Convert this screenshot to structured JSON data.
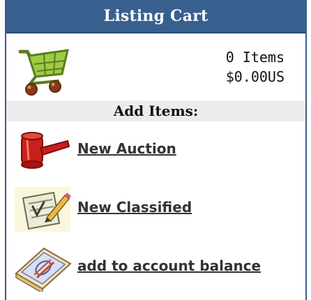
{
  "header": {
    "title": "Listing Cart"
  },
  "cart": {
    "item_count": "0 Items",
    "total": "$0.00US",
    "icon": "shopping-cart-icon"
  },
  "add_section": {
    "title": "Add Items:",
    "items": [
      {
        "label": "New Auction",
        "icon": "auction-gavel-icon"
      },
      {
        "label": "New Classified",
        "icon": "classified-note-icon"
      },
      {
        "label": "add to account balance",
        "icon": "money-stack-icon"
      }
    ]
  },
  "colors": {
    "header_bg": "#37608f",
    "section_bg": "#ececec",
    "link_text": "#333333",
    "cart_green": "#8fbf3c",
    "gavel_red": "#c8201c"
  }
}
